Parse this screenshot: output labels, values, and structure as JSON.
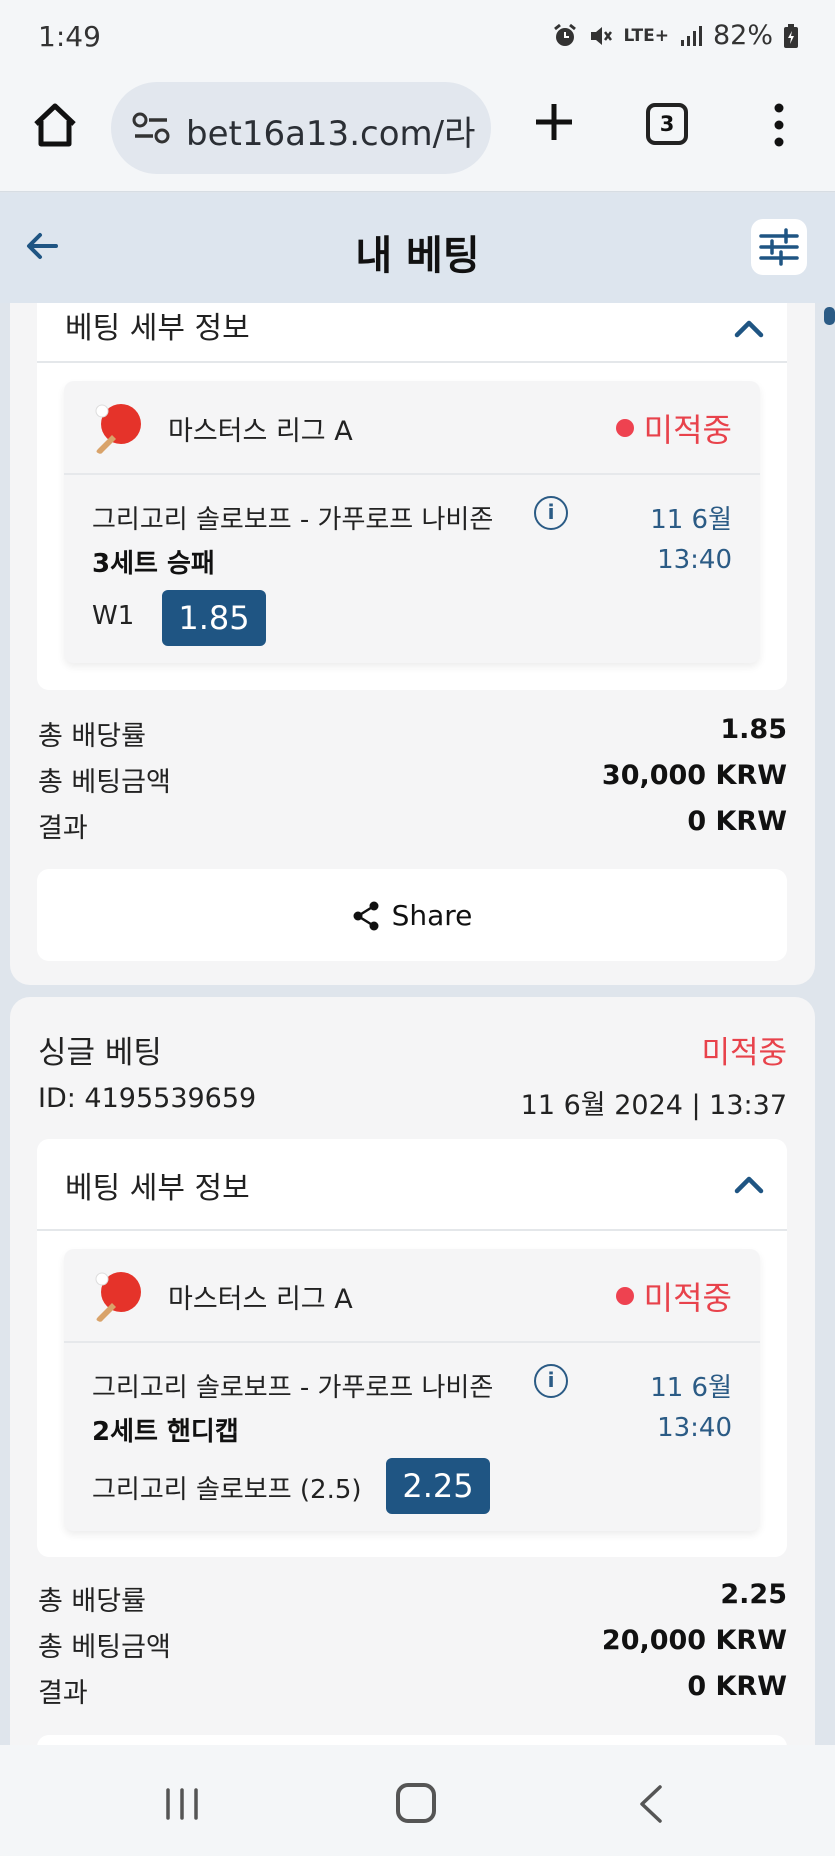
{
  "status_bar": {
    "time": "1:49",
    "network": "LTE+",
    "battery": "82%",
    "icons": [
      "alarm-icon",
      "mute-icon",
      "lte-icon",
      "signal-icon",
      "battery-icon"
    ]
  },
  "browser": {
    "url": "bet16a13.com/라",
    "tab_count": "3",
    "icons": [
      "home-icon",
      "site-settings-icon",
      "new-tab-icon",
      "tab-switcher-icon",
      "more-menu-icon"
    ]
  },
  "header": {
    "title": "내 베팅",
    "icons": [
      "back-arrow-icon",
      "filter-icon"
    ]
  },
  "bets": [
    {
      "details_title": "베팅 세부 정보",
      "league": "마스터스 리그 A",
      "status": "미적중",
      "teams": "그리고리 솔로보프 - 가푸로프 나비존",
      "date": "11 6월",
      "time": "13:40",
      "market": "3세트 승패",
      "pick": "W1",
      "odds": "1.85",
      "summary": [
        {
          "label": "총 배당률",
          "value": "1.85"
        },
        {
          "label": "총 베팅금액",
          "value": "30,000 KRW"
        },
        {
          "label": "결과",
          "value": "0 KRW"
        }
      ],
      "share_label": "Share"
    },
    {
      "type": "싱글 베팅",
      "card_status": "미적중",
      "id": "ID: 4195539659",
      "placed": "11 6월 2024 | 13:37",
      "details_title": "베팅 세부 정보",
      "league": "마스터스 리그 A",
      "status": "미적중",
      "teams": "그리고리 솔로보프 - 가푸로프 나비존",
      "date": "11 6월",
      "time": "13:40",
      "market": "2세트 핸디캡",
      "pick": "그리고리 솔로보프 (2.5)",
      "odds": "2.25",
      "summary": [
        {
          "label": "총 배당률",
          "value": "2.25"
        },
        {
          "label": "총 베팅금액",
          "value": "20,000 KRW"
        },
        {
          "label": "결과",
          "value": "0 KRW"
        }
      ]
    }
  ],
  "colors": {
    "accent": "#1f5583",
    "status_red": "#e8424b",
    "header_bg": "#dde5ee"
  }
}
